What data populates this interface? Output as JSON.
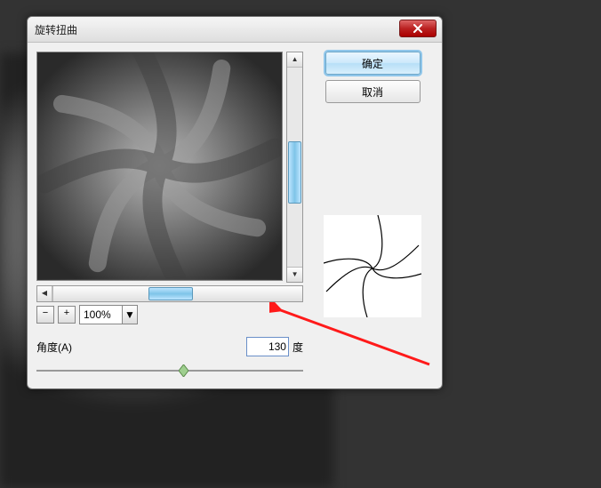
{
  "dialog": {
    "title": "旋转扭曲",
    "ok_label": "确定",
    "cancel_label": "取消",
    "zoom_minus": "−",
    "zoom_plus": "+",
    "zoom_value": "100%",
    "angle_label": "角度(A)",
    "angle_value": "130",
    "angle_unit": "度"
  }
}
